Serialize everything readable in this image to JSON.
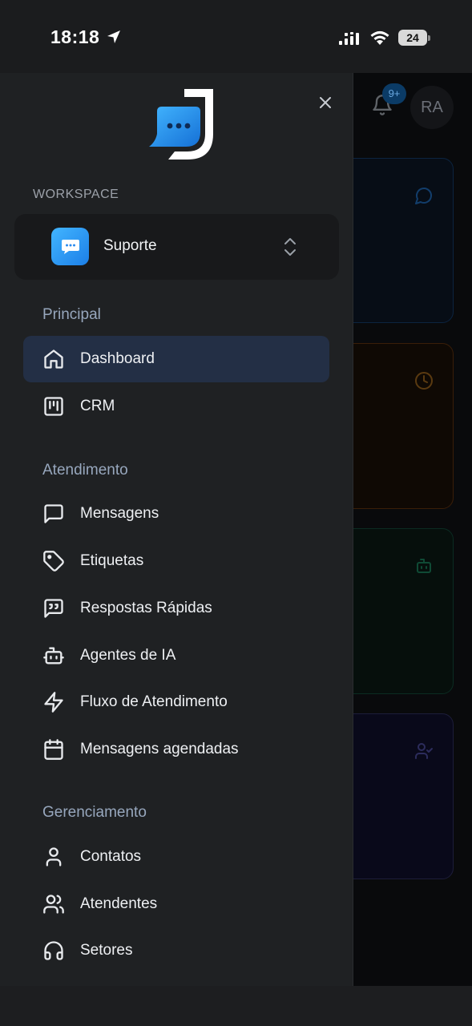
{
  "status_bar": {
    "time": "18:18",
    "battery": "24"
  },
  "background": {
    "notification_badge": "9+",
    "avatar_initials": "RA"
  },
  "workspace": {
    "label": "WORKSPACE",
    "name": "Suporte"
  },
  "sections": {
    "principal": "Principal",
    "atendimento": "Atendimento",
    "gerenciamento": "Gerenciamento"
  },
  "nav": {
    "dashboard": "Dashboard",
    "crm": "CRM",
    "mensagens": "Mensagens",
    "etiquetas": "Etiquetas",
    "respostas_rapidas": "Respostas Rápidas",
    "agentes_ia": "Agentes de IA",
    "fluxo_atendimento": "Fluxo de Atendimento",
    "mensagens_agendadas": "Mensagens agendadas",
    "contatos": "Contatos",
    "atendentes": "Atendentes",
    "setores": "Setores"
  },
  "icons": {
    "dashboard": "home-icon",
    "crm": "kanban-icon",
    "mensagens": "message-square-icon",
    "etiquetas": "tag-icon",
    "respostas_rapidas": "quote-message-icon",
    "agentes_ia": "bot-icon",
    "fluxo_atendimento": "zap-icon",
    "mensagens_agendadas": "calendar-icon",
    "contatos": "user-icon",
    "atendentes": "users-icon",
    "setores": "headphones-icon"
  },
  "colors": {
    "drawer_bg": "#1f2123",
    "active_item_bg": "#232f45",
    "section_label": "#97a7bd",
    "brand_blue": "#1c8ff0"
  }
}
